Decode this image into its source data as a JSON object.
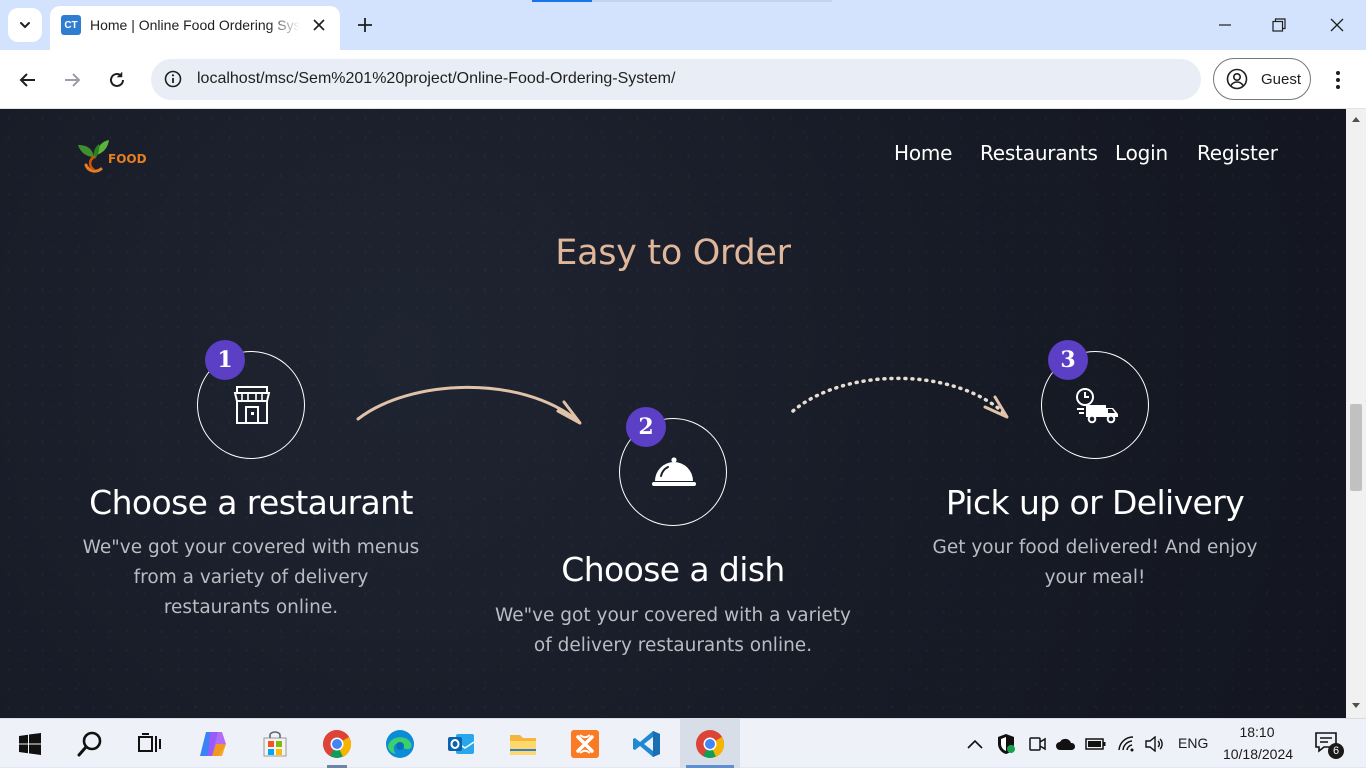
{
  "browser": {
    "tab_title": "Home | Online Food Ordering System",
    "tab_favicon_text": "CT",
    "url": "localhost/msc/Sem%201%20project/Online-Food-Ordering-System/",
    "profile_label": "Guest",
    "accent_color": "#1a73e8"
  },
  "site": {
    "logo_text": "FOOD",
    "nav": [
      {
        "label": "Home"
      },
      {
        "label": "Restaurants"
      },
      {
        "label": "Login"
      },
      {
        "label": "Register"
      }
    ],
    "section_title": "Easy to Order",
    "steps": [
      {
        "number": "1",
        "icon": "store-icon",
        "title": "Choose a restaurant",
        "description": "We\"ve got your covered with menus from a variety of delivery restaurants online."
      },
      {
        "number": "2",
        "icon": "food-cloche-icon",
        "title": "Choose a dish",
        "description": "We\"ve got your covered with a variety of delivery restaurants online."
      },
      {
        "number": "3",
        "icon": "delivery-truck-icon",
        "title": "Pick up or Delivery",
        "description": "Get your food delivered! And enjoy your meal!"
      }
    ],
    "title_color": "#e0b79a",
    "badge_color": "#5b3fc4"
  },
  "taskbar": {
    "apps": [
      "start-icon",
      "search-icon",
      "task-view-icon",
      "copilot-icon",
      "store-icon",
      "chrome-icon",
      "edge-icon",
      "outlook-icon",
      "file-explorer-icon",
      "xampp-icon",
      "vscode-icon",
      "chrome-icon"
    ],
    "language": "ENG",
    "time": "18:10",
    "date": "10/18/2024",
    "notification_count": "6"
  }
}
